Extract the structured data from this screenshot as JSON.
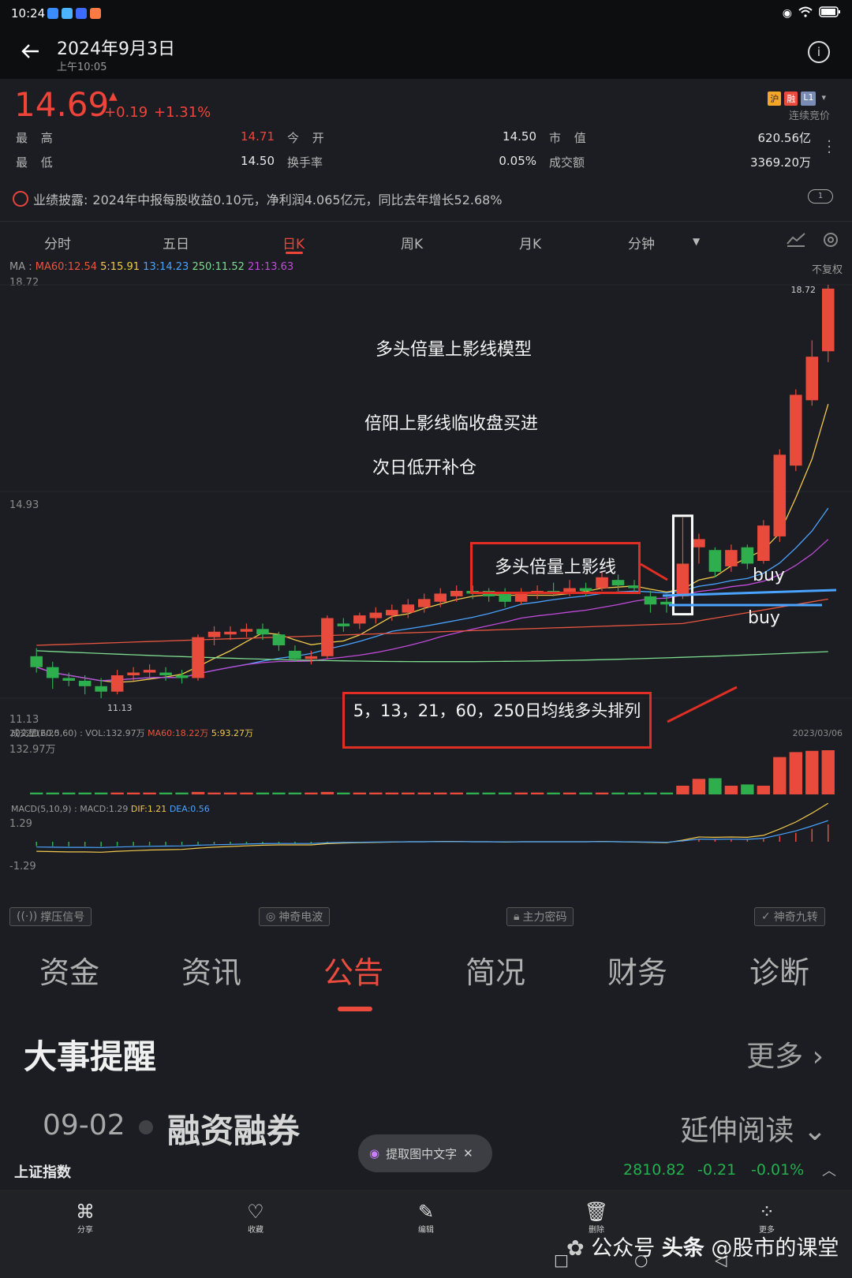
{
  "status": {
    "time": "10:24"
  },
  "header": {
    "title": "2024年9月3日",
    "subtitle": "上午10:05"
  },
  "quote": {
    "price": "14.69",
    "change": "+0.19",
    "change_pct": "+1.31%",
    "badge_hu": "沪",
    "badge_rong": "融",
    "badge_l1": "L1",
    "continuous_bid": "连续竞价",
    "high_label": "最 高",
    "high": "14.71",
    "open_label": "今 开",
    "open": "14.50",
    "mktcap_label": "市 值",
    "mktcap": "620.56亿",
    "low_label": "最 低",
    "low": "14.50",
    "turnover_label": "换手率",
    "turnover": "0.05%",
    "amount_label": "成交额",
    "amount": "3369.20万",
    "disclosure_label": "业绩披露:",
    "disclosure_text": "2024年中报每股收益0.10元，净利润4.065亿元，同比去年增长52.68%",
    "page_indicator": "1"
  },
  "chart_tabs": [
    "分时",
    "五日",
    "日K",
    "周K",
    "月K",
    "分钟"
  ],
  "active_chart_tab": "日K",
  "ma": {
    "prefix": "MA :",
    "ma60": "MA60:12.54",
    "ma5": "5:15.91",
    "ma13": "13:14.23",
    "ma250": "250:11.52",
    "ma21": "21:13.63",
    "adjust": "不复权"
  },
  "axis": {
    "y_top": "18.72",
    "y_mid": "14.93",
    "y_low": "11.13",
    "max_marker": "18.72",
    "min_marker": "11.13",
    "date_start": "2022/12/20",
    "date_end": "2023/03/06"
  },
  "volume": {
    "header": "成交量(60,5,60) : VOL:132.97万",
    "ma60": "MA60:18.22万",
    "ma5": "5:93.27万",
    "max": "132.97万"
  },
  "macd": {
    "header": "MACD(5,10,9) : MACD:1.29",
    "dif": "DIF:1.21",
    "dea": "DEA:0.56",
    "max": "1.29",
    "min": "-1.29"
  },
  "annotations": {
    "title": "多头倍量上影线模型",
    "line1": "倍阳上影线临收盘买进",
    "line2": "次日低开补仓",
    "box1": "多头倍量上影线",
    "buy1": "buy",
    "buy2": "buy",
    "box2": "5，13，21，60，250日均线多头排列"
  },
  "signal_tags": [
    "撑压信号",
    "神奇电波",
    "主力密码",
    "神奇九转"
  ],
  "section_tabs": [
    "资金",
    "资讯",
    "公告",
    "简况",
    "财务",
    "诊断"
  ],
  "active_section_tab": "公告",
  "events": {
    "title": "大事提醒",
    "more": "更多",
    "date": "09-02",
    "name": "融资融券",
    "read_more": "延伸阅读"
  },
  "ocr_button": "提取图中文字",
  "index_ticker": {
    "name": "上证指数",
    "value": "2810.82",
    "change": "-0.21",
    "change_pct": "-0.01%"
  },
  "bottom_actions": [
    "分享",
    "收藏",
    "编辑",
    "删除",
    "更多"
  ],
  "watermark": {
    "prefix": "公众号",
    "brand": "头条",
    "account": "@股市的课堂"
  },
  "chart_data": {
    "type": "candlestick",
    "ylim": [
      11.13,
      18.72
    ],
    "candles": [
      {
        "o": 11.9,
        "c": 11.7,
        "h": 12.05,
        "l": 11.6
      },
      {
        "o": 11.7,
        "c": 11.5,
        "h": 11.8,
        "l": 11.3
      },
      {
        "o": 11.5,
        "c": 11.45,
        "h": 11.6,
        "l": 11.35
      },
      {
        "o": 11.45,
        "c": 11.35,
        "h": 11.55,
        "l": 11.2
      },
      {
        "o": 11.35,
        "c": 11.25,
        "h": 11.5,
        "l": 11.13
      },
      {
        "o": 11.25,
        "c": 11.55,
        "h": 11.65,
        "l": 11.2
      },
      {
        "o": 11.55,
        "c": 11.6,
        "h": 11.7,
        "l": 11.45
      },
      {
        "o": 11.6,
        "c": 11.65,
        "h": 11.75,
        "l": 11.5
      },
      {
        "o": 11.6,
        "c": 11.55,
        "h": 11.7,
        "l": 11.45
      },
      {
        "o": 11.55,
        "c": 11.5,
        "h": 11.65,
        "l": 11.4
      },
      {
        "o": 11.5,
        "c": 12.25,
        "h": 12.3,
        "l": 11.45
      },
      {
        "o": 12.25,
        "c": 12.35,
        "h": 12.45,
        "l": 12.1
      },
      {
        "o": 12.3,
        "c": 12.35,
        "h": 12.45,
        "l": 12.2
      },
      {
        "o": 12.35,
        "c": 12.4,
        "h": 12.5,
        "l": 12.25
      },
      {
        "o": 12.4,
        "c": 12.3,
        "h": 12.5,
        "l": 12.2
      },
      {
        "o": 12.3,
        "c": 12.1,
        "h": 12.35,
        "l": 12.0
      },
      {
        "o": 12.0,
        "c": 11.85,
        "h": 12.1,
        "l": 11.8
      },
      {
        "o": 11.85,
        "c": 11.9,
        "h": 12.0,
        "l": 11.75
      },
      {
        "o": 11.9,
        "c": 12.6,
        "h": 12.65,
        "l": 11.85
      },
      {
        "o": 12.5,
        "c": 12.45,
        "h": 12.6,
        "l": 12.35
      },
      {
        "o": 12.5,
        "c": 12.65,
        "h": 12.7,
        "l": 12.4
      },
      {
        "o": 12.6,
        "c": 12.7,
        "h": 12.8,
        "l": 12.5
      },
      {
        "o": 12.65,
        "c": 12.75,
        "h": 12.85,
        "l": 12.55
      },
      {
        "o": 12.7,
        "c": 12.85,
        "h": 12.95,
        "l": 12.6
      },
      {
        "o": 12.8,
        "c": 12.95,
        "h": 13.05,
        "l": 12.7
      },
      {
        "o": 12.9,
        "c": 13.05,
        "h": 13.15,
        "l": 12.8
      },
      {
        "o": 13.0,
        "c": 13.1,
        "h": 13.2,
        "l": 12.9
      },
      {
        "o": 13.1,
        "c": 13.05,
        "h": 13.2,
        "l": 12.95
      },
      {
        "o": 13.1,
        "c": 13.0,
        "h": 13.15,
        "l": 12.9
      },
      {
        "o": 13.05,
        "c": 12.9,
        "h": 13.15,
        "l": 12.8
      },
      {
        "o": 12.9,
        "c": 13.05,
        "h": 13.15,
        "l": 12.85
      },
      {
        "o": 13.05,
        "c": 13.1,
        "h": 13.2,
        "l": 12.95
      },
      {
        "o": 13.1,
        "c": 13.05,
        "h": 13.25,
        "l": 13.0
      },
      {
        "o": 13.05,
        "c": 13.15,
        "h": 13.3,
        "l": 13.0
      },
      {
        "o": 13.15,
        "c": 13.1,
        "h": 13.25,
        "l": 13.0
      },
      {
        "o": 13.15,
        "c": 13.35,
        "h": 13.45,
        "l": 13.1
      },
      {
        "o": 13.3,
        "c": 13.2,
        "h": 13.4,
        "l": 13.1
      },
      {
        "o": 13.2,
        "c": 13.15,
        "h": 13.3,
        "l": 13.05
      },
      {
        "o": 13.0,
        "c": 12.85,
        "h": 13.1,
        "l": 12.7
      },
      {
        "o": 12.9,
        "c": 12.85,
        "h": 13.0,
        "l": 12.7
      },
      {
        "o": 13.0,
        "c": 13.6,
        "h": 14.45,
        "l": 12.95
      },
      {
        "o": 13.9,
        "c": 14.05,
        "h": 14.15,
        "l": 13.6
      },
      {
        "o": 13.85,
        "c": 13.45,
        "h": 13.9,
        "l": 13.35
      },
      {
        "o": 13.55,
        "c": 13.85,
        "h": 13.95,
        "l": 13.45
      },
      {
        "o": 13.9,
        "c": 13.6,
        "h": 13.95,
        "l": 13.5
      },
      {
        "o": 13.65,
        "c": 14.3,
        "h": 14.4,
        "l": 13.6
      },
      {
        "o": 14.1,
        "c": 15.6,
        "h": 15.7,
        "l": 14.0
      },
      {
        "o": 15.4,
        "c": 16.7,
        "h": 16.8,
        "l": 15.3
      },
      {
        "o": 16.6,
        "c": 17.4,
        "h": 17.7,
        "l": 16.5
      },
      {
        "o": 17.5,
        "c": 18.65,
        "h": 18.72,
        "l": 17.3
      }
    ],
    "volume": [
      3,
      3,
      3,
      3,
      3,
      3,
      3,
      3,
      3,
      3,
      4,
      3,
      3,
      3,
      3,
      3,
      3,
      3,
      4,
      3,
      3,
      3,
      3,
      3,
      3,
      3,
      3,
      3,
      3,
      3,
      3,
      3,
      3,
      3,
      3,
      3,
      3,
      3,
      3,
      3,
      14,
      25,
      26,
      14,
      16,
      14,
      60,
      68,
      70,
      71
    ],
    "macd_dif": [
      -0.3,
      -0.31,
      -0.32,
      -0.32,
      -0.33,
      -0.3,
      -0.28,
      -0.26,
      -0.25,
      -0.24,
      -0.2,
      -0.17,
      -0.15,
      -0.13,
      -0.11,
      -0.1,
      -0.1,
      -0.1,
      -0.06,
      -0.04,
      -0.03,
      -0.02,
      -0.01,
      0.0,
      0.0,
      0.01,
      0.01,
      0.0,
      0.0,
      -0.01,
      0.0,
      0.0,
      0.0,
      0.0,
      0.0,
      0.01,
      0.0,
      -0.01,
      -0.02,
      -0.03,
      0.05,
      0.15,
      0.14,
      0.15,
      0.14,
      0.2,
      0.4,
      0.62,
      0.9,
      1.21
    ]
  }
}
